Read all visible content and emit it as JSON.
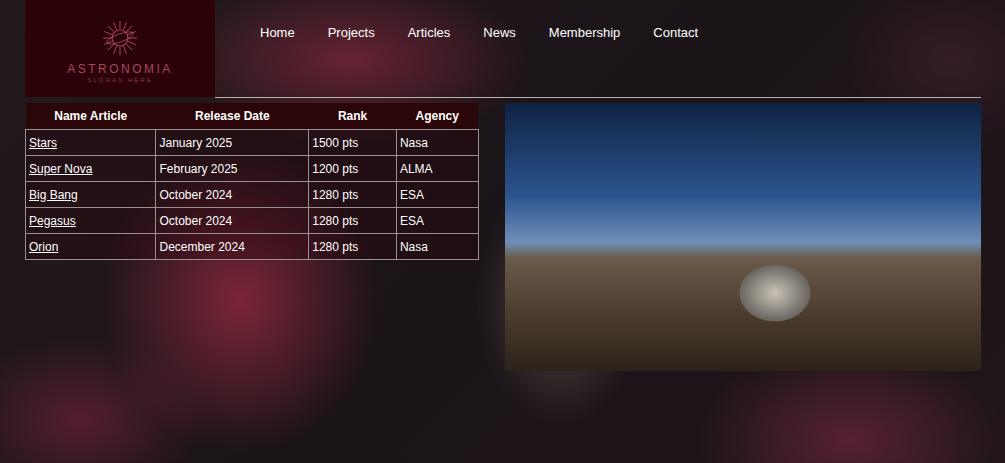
{
  "logo": {
    "title": "ASTRONOMIA",
    "slogan": "SLOGAN HERE"
  },
  "nav": [
    {
      "label": "Home"
    },
    {
      "label": "Projects"
    },
    {
      "label": "Articles"
    },
    {
      "label": "News"
    },
    {
      "label": "Membership"
    },
    {
      "label": "Contact"
    }
  ],
  "table": {
    "columns": [
      "Name Article",
      "Release Date",
      "Rank",
      "Agency"
    ],
    "rows": [
      {
        "name": "Stars",
        "date": "January 2025",
        "rank": "1500 pts",
        "agency": "Nasa"
      },
      {
        "name": "Super Nova",
        "date": "February 2025",
        "rank": "1200 pts",
        "agency": "ALMA"
      },
      {
        "name": "Big Bang",
        "date": "October 2024",
        "rank": "1280 pts",
        "agency": "ESA"
      },
      {
        "name": "Pegasus",
        "date": "October 2024",
        "rank": "1280 pts",
        "agency": "ESA"
      },
      {
        "name": "Orion",
        "date": "December 2024",
        "rank": "1280 pts",
        "agency": "Nasa"
      }
    ]
  }
}
